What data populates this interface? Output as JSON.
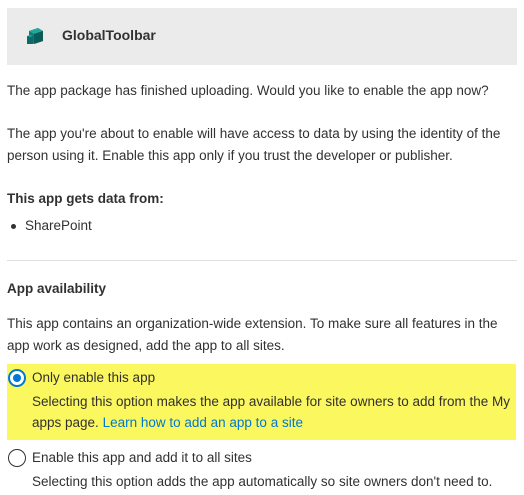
{
  "header": {
    "app_icon": "teal-cube-app-icon",
    "app_name": "GlobalToolbar"
  },
  "intro": {
    "upload_message": "The app package has finished uploading. Would you like to enable the app now?",
    "access_message": "The app you're about to enable will have access to data by using the identity of the person using it. Enable this app only if you trust the developer or publisher."
  },
  "data_sources": {
    "heading": "This app gets data from:",
    "items": [
      "SharePoint"
    ]
  },
  "availability": {
    "heading": "App availability",
    "description": "This app contains an organization-wide extension. To make sure all features in the app work as designed, add the app to all sites.",
    "options": [
      {
        "label": "Only enable this app",
        "description": "Selecting this option makes the app available for site owners to add from the My apps page.",
        "link_text": "Learn how to add an app to a site",
        "selected": true
      },
      {
        "label": "Enable this app and add it to all sites",
        "description": "Selecting this option adds the app automatically so site owners don't need to.",
        "selected": false
      }
    ]
  },
  "colors": {
    "accent": "#0078d4",
    "highlight": "#fbf75f",
    "header_bg": "#ebebeb",
    "app_icon": "#0b6a6a"
  }
}
